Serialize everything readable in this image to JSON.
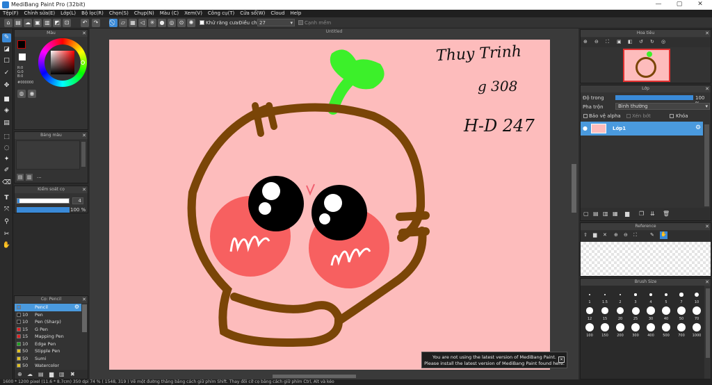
{
  "app": {
    "title": "MediBang Paint Pro (32bit)",
    "window_controls": [
      "—",
      "▢",
      "✕"
    ]
  },
  "menu": [
    "Tệp(F)",
    "Chỉnh sửa(E)",
    "Lớp(L)",
    "Bộ lọc(R)",
    "Chọn(S)",
    "Chụp(N)",
    "Màu (C)",
    "Xem(V)",
    "Công cụ(T)",
    "Cửa sổ(W)",
    "Cloud",
    "Help"
  ],
  "toolbar": {
    "antialias_label": "Khử răng cưa",
    "adjust_label": "Điều chỉnh",
    "adjust_value": "27",
    "edge_label": "Cạnh mềm"
  },
  "color_panel": {
    "title": "Màu",
    "rgb": [
      "R:0",
      "G:0",
      "B:0"
    ],
    "hex": "#000000"
  },
  "palette_panel": {
    "title": "Bảng màu",
    "more": "..."
  },
  "brush_control": {
    "title": "Kiểm soát cọ",
    "size_value": "4",
    "opacity_value": "100 %"
  },
  "brush_panel": {
    "title": "Cọ: Pencil",
    "items": [
      {
        "size": "",
        "name": "Pencil",
        "color": "#3a8ad8",
        "selected": true
      },
      {
        "size": "10",
        "name": "Pen",
        "color": "#222222",
        "selected": false
      },
      {
        "size": "10",
        "name": "Pen (Sharp)",
        "color": "#222222",
        "selected": false
      },
      {
        "size": "15",
        "name": "G Pen",
        "color": "#e02020",
        "selected": false
      },
      {
        "size": "15",
        "name": "Mapping Pen",
        "color": "#e02020",
        "selected": false
      },
      {
        "size": "10",
        "name": "Edge Pen",
        "color": "#20a020",
        "selected": false
      },
      {
        "size": "50",
        "name": "Stipple Pen",
        "color": "#e0c020",
        "selected": false
      },
      {
        "size": "50",
        "name": "Sumi",
        "color": "#e0c020",
        "selected": false
      },
      {
        "size": "50",
        "name": "Watercolor",
        "color": "#e0c020",
        "selected": false
      }
    ]
  },
  "document": {
    "tab": "Untitled",
    "handwriting_lines": [
      "Thuy Trinh",
      "g 308",
      "H-D 247"
    ]
  },
  "navigator": {
    "title": "Hoa tiêu"
  },
  "layer_panel": {
    "title": "Lớp",
    "opacity_label": "Độ trong",
    "opacity_value": "100 %",
    "opacity_fraction": 1.0,
    "blend_label": "Pha trộn",
    "blend_value": "Bình thường",
    "protect_alpha": "Bảo vệ alpha",
    "clipping": "Xén bớt",
    "lock": "Khóa",
    "layer_name": "Lớp1"
  },
  "reference_panel": {
    "title": "Reference"
  },
  "brush_size_panel": {
    "title": "Brush Size",
    "sizes": [
      "1",
      "1.5",
      "2",
      "3",
      "4",
      "5",
      "7",
      "10",
      "12",
      "15",
      "20",
      "25",
      "30",
      "40",
      "50",
      "70",
      "100",
      "150",
      "200",
      "300",
      "400",
      "500",
      "700",
      "1000"
    ]
  },
  "notice": {
    "line1": "You are not using the latest version of MediBang Paint.",
    "line2": "Please install the latest version of MediBang Paint found here.",
    "close": "✕"
  },
  "status": {
    "text": "1600 * 1200 pixel   (11.6 * 8.7cm)   350 dpi   74 %   ( 1548, 319 )   Vẽ một đường thẳng bằng cách giữ phím Shift. Thay đổi cỡ cọ bằng cách giữ phím Ctrl, Alt và kéo"
  },
  "colors": {
    "canvas_bg": "#fdbcbc",
    "outline": "#7a4507",
    "sprout": "#3cf02a",
    "cheek": "#f76060",
    "accent": "#3a8ad8"
  }
}
